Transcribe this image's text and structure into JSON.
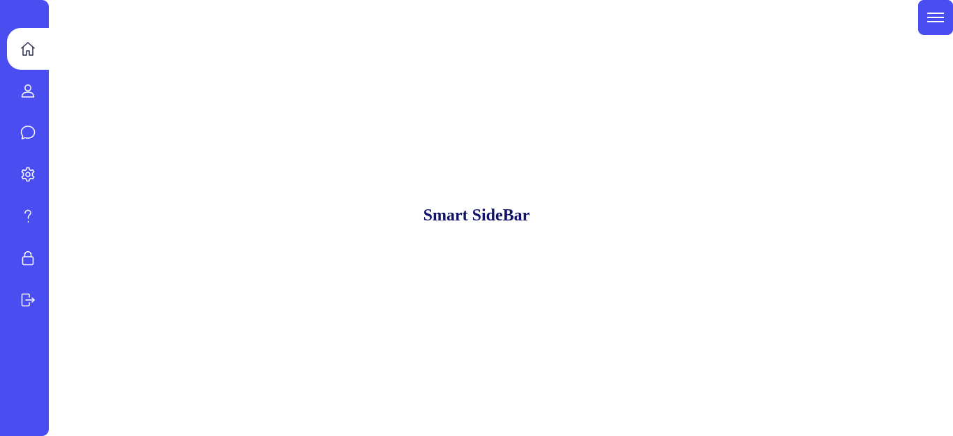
{
  "app": {
    "title": "Smart SideBar"
  },
  "sidebar": {
    "items": [
      {
        "icon": "home-icon",
        "active": true
      },
      {
        "icon": "user-icon",
        "active": false
      },
      {
        "icon": "chat-icon",
        "active": false
      },
      {
        "icon": "gear-icon",
        "active": false
      },
      {
        "icon": "help-icon",
        "active": false
      },
      {
        "icon": "lock-icon",
        "active": false
      },
      {
        "icon": "logout-icon",
        "active": false
      }
    ]
  },
  "header": {
    "menu_icon": "hamburger-icon"
  },
  "colors": {
    "accent": "#4a4ef0",
    "title": "#12126b",
    "background": "#ffffff"
  }
}
